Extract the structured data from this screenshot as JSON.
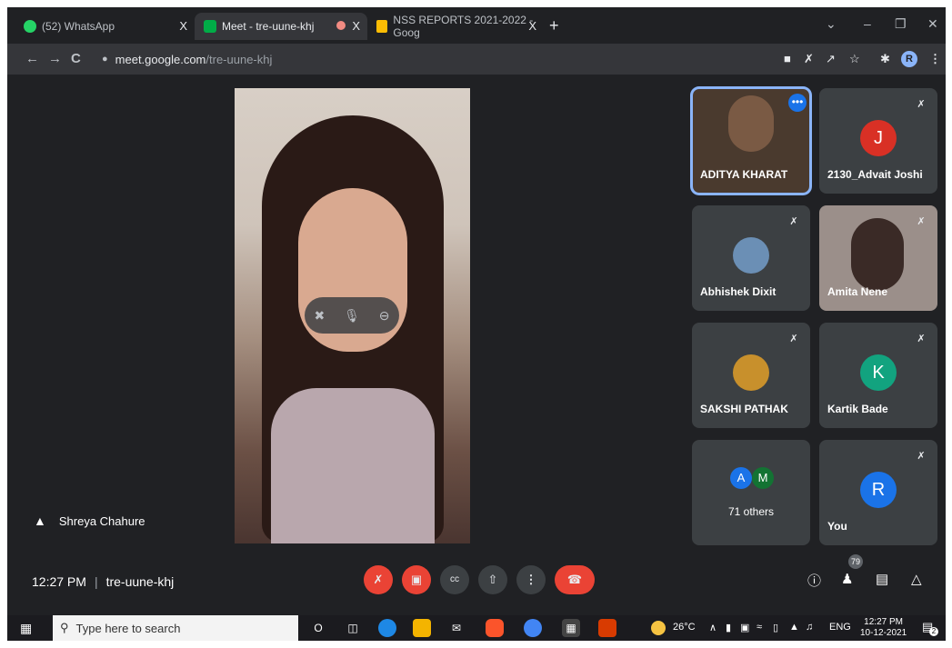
{
  "browser": {
    "tabs": [
      {
        "title": "(52) WhatsApp",
        "close": "X"
      },
      {
        "title": "Meet - tre-uune-khj",
        "close": "X"
      },
      {
        "title": "NSS REPORTS 2021-2022 - Goog",
        "close": "X"
      }
    ],
    "new_tab": "+",
    "window_controls": {
      "dropdown": "⌄",
      "minimize": "–",
      "restore": "❐",
      "close": "✕"
    },
    "nav": {
      "back": "←",
      "forward": "→",
      "reload": "C"
    },
    "url": {
      "host": "meet.google.com",
      "path": "/tre-uune-khj"
    },
    "profile_initial": "R"
  },
  "meeting": {
    "main_speaker": "Shreya Chahure",
    "time": "12:27 PM",
    "separator": "|",
    "code": "tre-uune-khj",
    "participants_count": "79",
    "tiles": [
      {
        "name": "ADITYA KHARAT"
      },
      {
        "name": "2130_Advait Joshi",
        "initial": "J",
        "color": "#d93025"
      },
      {
        "name": "Abhishek Dixit"
      },
      {
        "name": "Amita Nene"
      },
      {
        "name": "SAKSHI PATHAK"
      },
      {
        "name": "Kartik Bade",
        "initial": "K",
        "color": "#12a37f"
      },
      {
        "name": "71 others",
        "initials": [
          "A",
          "M"
        ],
        "colors": [
          "#1a73e8",
          "#137333"
        ]
      },
      {
        "name": "You",
        "initial": "R",
        "color": "#1a73e8"
      }
    ]
  },
  "taskbar": {
    "search_placeholder": "Type here to search",
    "weather": "26°C",
    "language": "ENG",
    "time": "12:27 PM",
    "date": "10-12-2021",
    "notification_count": "2"
  },
  "colors": {
    "meet_bg": "#202124",
    "tile_bg": "#3c4043",
    "red_control": "#ea4335",
    "selected_outline": "#8ab4f8"
  }
}
